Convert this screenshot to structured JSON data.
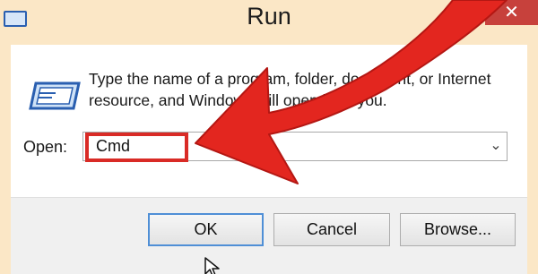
{
  "window": {
    "title": "Run",
    "close_glyph": "✕",
    "app_icon": "run-app-icon"
  },
  "dialog": {
    "description": "Type the name of a program, folder, document, or Internet resource, and Windows will open it for you.",
    "open_label": "Open:",
    "open_value": "Cmd",
    "dropdown_glyph": "⌄",
    "buttons": {
      "ok": "OK",
      "cancel": "Cancel",
      "browse": "Browse..."
    }
  },
  "annotation": {
    "arrow_color": "#e3261f",
    "highlight_color": "#d92b26"
  },
  "colors": {
    "titlebar": "#fbe7c6",
    "close_button": "#c7413c",
    "ok_focus_border": "#4f8fd6"
  }
}
